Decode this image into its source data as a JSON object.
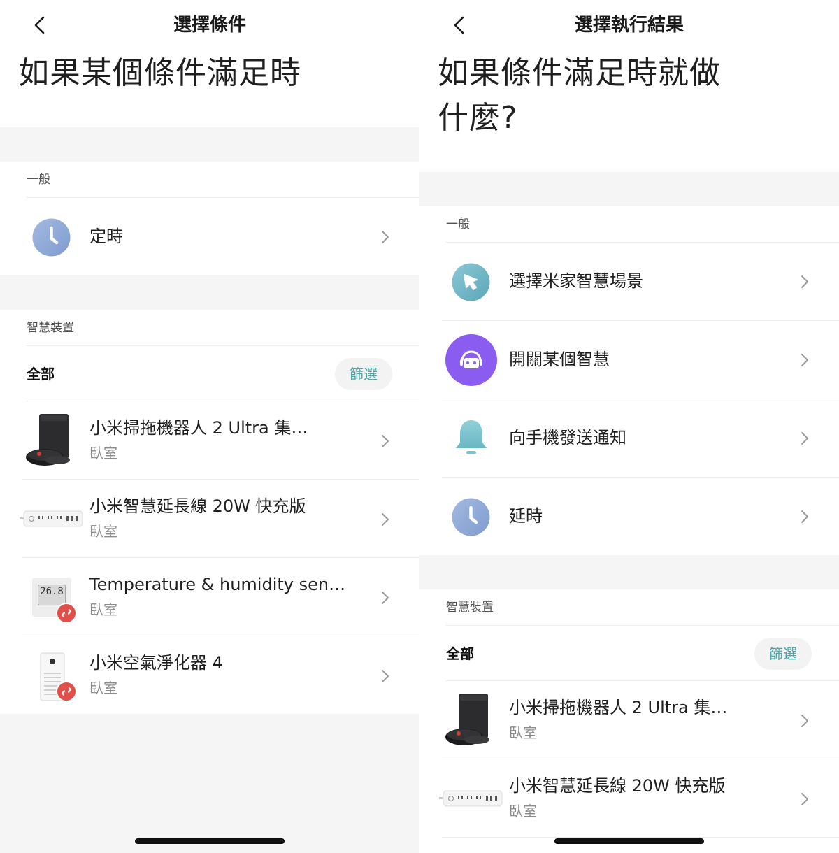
{
  "left": {
    "nav_title": "選擇條件",
    "big_title": "如果某個條件滿足時",
    "general_label": "一般",
    "timer_label": "定時",
    "devices_label": "智慧裝置",
    "all_label": "全部",
    "filter_label": "篩選",
    "thermo_display": "26.8",
    "devices": [
      {
        "name": "小米掃拖機器人 2 Ultra 集…",
        "room": "臥室"
      },
      {
        "name": "小米智慧延長線 20W 快充版",
        "room": "臥室"
      },
      {
        "name": "Temperature & humidity sen…",
        "room": "臥室"
      },
      {
        "name": "小米空氣淨化器 4",
        "room": "臥室"
      }
    ]
  },
  "right": {
    "nav_title": "選擇執行結果",
    "big_title_line1": "如果條件滿足時就做",
    "big_title_line2": "什麼?",
    "general_label": "一般",
    "actions": [
      {
        "label": "選擇米家智慧場景",
        "icon": "cursor-icon"
      },
      {
        "label": "開關某個智慧",
        "icon": "robot-icon"
      },
      {
        "label": "向手機發送通知",
        "icon": "bell-icon"
      },
      {
        "label": "延時",
        "icon": "clock-icon"
      }
    ],
    "devices_label": "智慧裝置",
    "all_label": "全部",
    "filter_label": "篩選",
    "devices": [
      {
        "name": "小米掃拖機器人 2 Ultra 集…",
        "room": "臥室"
      },
      {
        "name": "小米智慧延長線 20W 快充版",
        "room": "臥室"
      }
    ]
  },
  "colors": {
    "accent_teal": "#4aa8ab",
    "clock_blue": "#8ea9d8",
    "scene_teal": "#6fb8c8",
    "robot_purple": "#8b5cf0",
    "bell_teal": "#7cc5cf",
    "offline_red": "#e0504a"
  }
}
